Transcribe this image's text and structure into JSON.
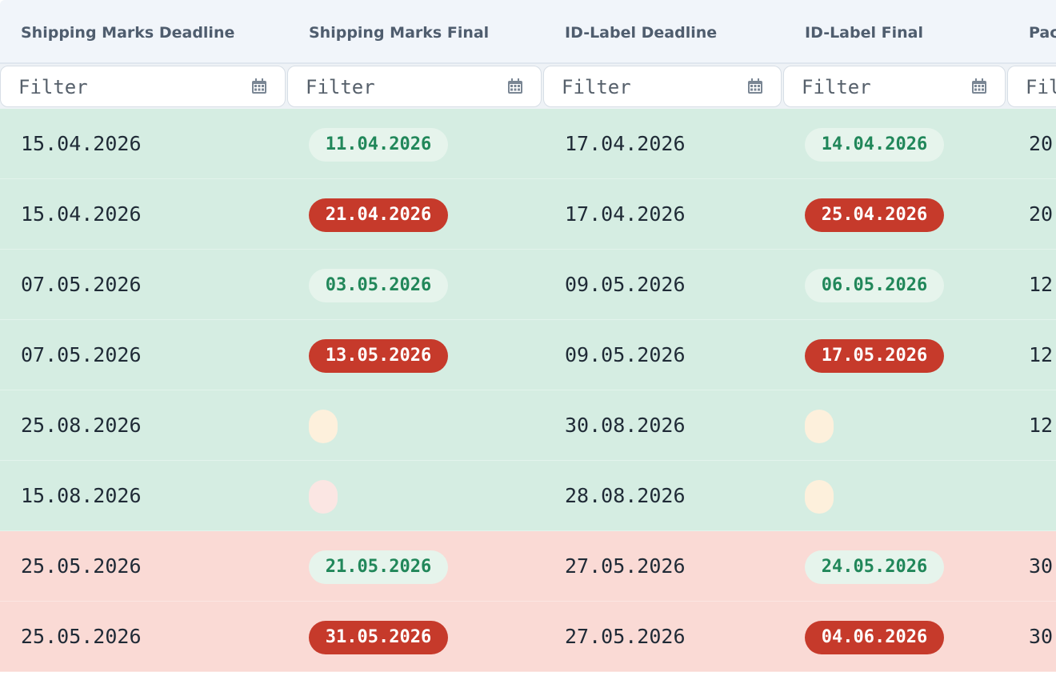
{
  "columns": [
    {
      "header": "Shipping Marks Deadline",
      "filter_placeholder": "Filter"
    },
    {
      "header": "Shipping Marks Final",
      "filter_placeholder": "Filter"
    },
    {
      "header": "ID-Label Deadline",
      "filter_placeholder": "Filter"
    },
    {
      "header": "ID-Label Final",
      "filter_placeholder": "Filter"
    },
    {
      "header": "Pac",
      "filter_placeholder": "Fil"
    }
  ],
  "rows": [
    {
      "row_status": "green",
      "sm_deadline": "15.04.2026",
      "sm_final": "11.04.2026",
      "sm_final_status": "ok",
      "id_deadline": "17.04.2026",
      "id_final": "14.04.2026",
      "id_final_status": "ok",
      "next": "20"
    },
    {
      "row_status": "green",
      "sm_deadline": "15.04.2026",
      "sm_final": "21.04.2026",
      "sm_final_status": "late",
      "id_deadline": "17.04.2026",
      "id_final": "25.04.2026",
      "id_final_status": "late",
      "next": "20"
    },
    {
      "row_status": "green",
      "sm_deadline": "07.05.2026",
      "sm_final": "03.05.2026",
      "sm_final_status": "ok",
      "id_deadline": "09.05.2026",
      "id_final": "06.05.2026",
      "id_final_status": "ok",
      "next": "12"
    },
    {
      "row_status": "green",
      "sm_deadline": "07.05.2026",
      "sm_final": "13.05.2026",
      "sm_final_status": "late",
      "id_deadline": "09.05.2026",
      "id_final": "17.05.2026",
      "id_final_status": "late",
      "next": "12"
    },
    {
      "row_status": "green",
      "sm_deadline": "25.08.2026",
      "sm_final": "",
      "sm_final_status": "empty-yellow",
      "id_deadline": "30.08.2026",
      "id_final": "",
      "id_final_status": "empty-yellow",
      "next": "12"
    },
    {
      "row_status": "green",
      "sm_deadline": "15.08.2026",
      "sm_final": "",
      "sm_final_status": "empty-pink",
      "id_deadline": "28.08.2026",
      "id_final": "",
      "id_final_status": "empty-yellow",
      "next": ""
    },
    {
      "row_status": "red",
      "sm_deadline": "25.05.2026",
      "sm_final": "21.05.2026",
      "sm_final_status": "ok",
      "id_deadline": "27.05.2026",
      "id_final": "24.05.2026",
      "id_final_status": "ok",
      "next": "30"
    },
    {
      "row_status": "red",
      "sm_deadline": "25.05.2026",
      "sm_final": "31.05.2026",
      "sm_final_status": "late",
      "id_deadline": "27.05.2026",
      "id_final": "04.06.2026",
      "id_final_status": "late",
      "next": "30"
    }
  ],
  "colors": {
    "row_green": "#d5ede2",
    "row_red": "#fadad5",
    "pill_ok": "#e6f4ec",
    "pill_late": "#c63a2b"
  },
  "icons": {
    "filter": "calendar-icon"
  }
}
